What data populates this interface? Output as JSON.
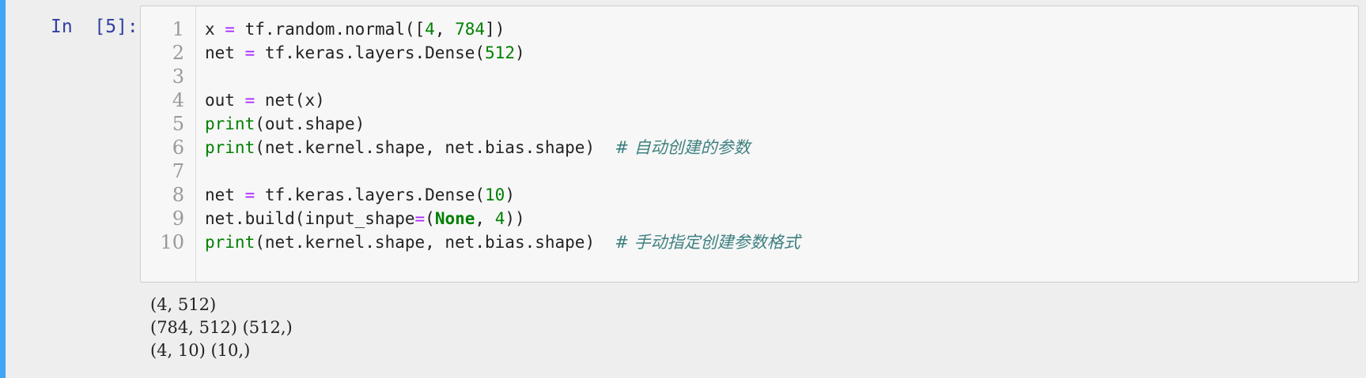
{
  "cell": {
    "prompt": "In  [5]:",
    "line_numbers": [
      "1",
      "2",
      "3",
      "4",
      "5",
      "6",
      "7",
      "8",
      "9",
      "10"
    ],
    "code": [
      [
        {
          "t": "x ",
          "c": ""
        },
        {
          "t": "=",
          "c": "kw-op"
        },
        {
          "t": " tf.random.normal([",
          "c": ""
        },
        {
          "t": "4",
          "c": "num"
        },
        {
          "t": ", ",
          "c": ""
        },
        {
          "t": "784",
          "c": "num"
        },
        {
          "t": "])",
          "c": ""
        }
      ],
      [
        {
          "t": "net ",
          "c": ""
        },
        {
          "t": "=",
          "c": "kw-op"
        },
        {
          "t": " tf.keras.layers.Dense(",
          "c": ""
        },
        {
          "t": "512",
          "c": "num"
        },
        {
          "t": ")",
          "c": ""
        }
      ],
      [],
      [
        {
          "t": "out ",
          "c": ""
        },
        {
          "t": "=",
          "c": "kw-op"
        },
        {
          "t": " net(x)",
          "c": ""
        }
      ],
      [
        {
          "t": "print",
          "c": "kw-fn"
        },
        {
          "t": "(out.shape)",
          "c": ""
        }
      ],
      [
        {
          "t": "print",
          "c": "kw-fn"
        },
        {
          "t": "(net.kernel.shape, net.bias.shape)  ",
          "c": ""
        },
        {
          "t": "# 自动创建的参数",
          "c": "comment"
        }
      ],
      [],
      [
        {
          "t": "net ",
          "c": ""
        },
        {
          "t": "=",
          "c": "kw-op"
        },
        {
          "t": " tf.keras.layers.Dense(",
          "c": ""
        },
        {
          "t": "10",
          "c": "num"
        },
        {
          "t": ")",
          "c": ""
        }
      ],
      [
        {
          "t": "net.build(input_shape",
          "c": ""
        },
        {
          "t": "=",
          "c": "kw-op"
        },
        {
          "t": "(",
          "c": ""
        },
        {
          "t": "None",
          "c": "const"
        },
        {
          "t": ", ",
          "c": ""
        },
        {
          "t": "4",
          "c": "num"
        },
        {
          "t": "))",
          "c": ""
        }
      ],
      [
        {
          "t": "print",
          "c": "kw-fn"
        },
        {
          "t": "(net.kernel.shape, net.bias.shape)  ",
          "c": ""
        },
        {
          "t": "# 手动指定创建参数格式",
          "c": "comment"
        }
      ]
    ]
  },
  "output": {
    "lines": [
      "(4, 512)",
      "(784, 512) (512,)",
      "(4, 10) (10,)"
    ]
  }
}
